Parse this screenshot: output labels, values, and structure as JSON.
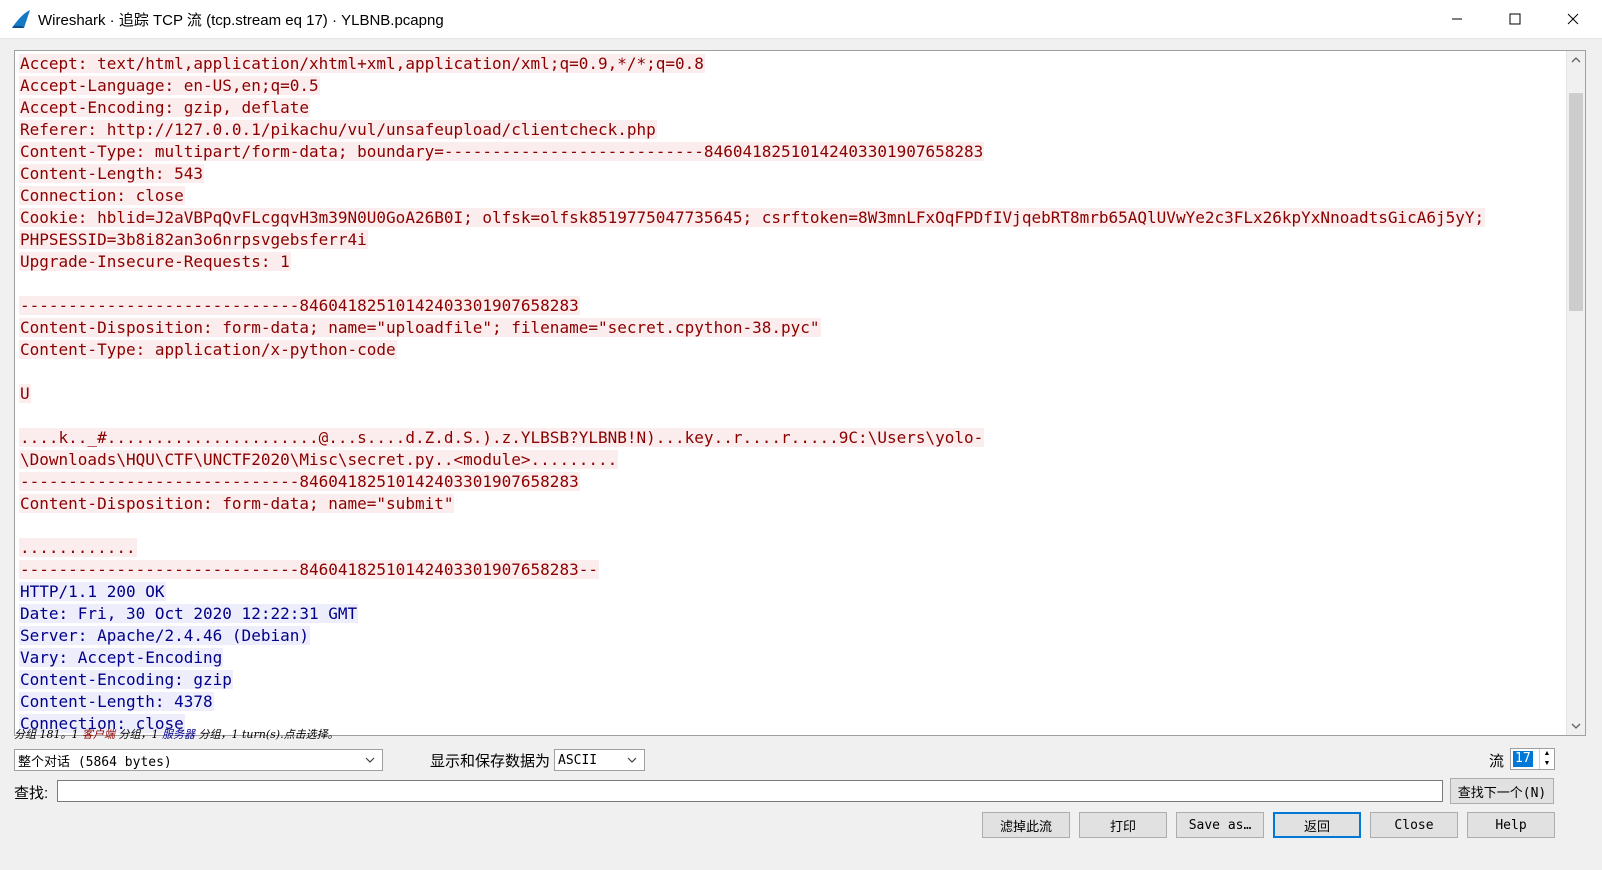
{
  "window": {
    "title": "Wireshark · 追踪 TCP 流 (tcp.stream eq 17) · YLBNB.pcapng"
  },
  "stream_lines": [
    {
      "side": "client",
      "text": "Accept: text/html,application/xhtml+xml,application/xml;q=0.9,*/*;q=0.8"
    },
    {
      "side": "client",
      "text": "Accept-Language: en-US,en;q=0.5"
    },
    {
      "side": "client",
      "text": "Accept-Encoding: gzip, deflate"
    },
    {
      "side": "client",
      "text": "Referer: http://127.0.0.1/pikachu/vul/unsafeupload/clientcheck.php"
    },
    {
      "side": "client",
      "text": "Content-Type: multipart/form-data; boundary=---------------------------84604182510142403301907658283"
    },
    {
      "side": "client",
      "text": "Content-Length: 543"
    },
    {
      "side": "client",
      "text": "Connection: close"
    },
    {
      "side": "client",
      "text": "Cookie: hblid=J2aVBPqQvFLcgqvH3m39N0U0GoA26B0I; olfsk=olfsk8519775047735645; csrftoken=8W3mnLFxOqFPDfIVjqebRT8mrb65AQlUVwYe2c3FLx26kpYxNnoadtsGicA6j5yY;"
    },
    {
      "side": "client",
      "text": "PHPSESSID=3b8i82an3o6nrpsvgebsferr4i"
    },
    {
      "side": "client",
      "text": "Upgrade-Insecure-Requests: 1"
    },
    {
      "side": "blank",
      "text": ""
    },
    {
      "side": "client",
      "text": "-----------------------------84604182510142403301907658283"
    },
    {
      "side": "client",
      "text": "Content-Disposition: form-data; name=\"uploadfile\"; filename=\"secret.cpython-38.pyc\""
    },
    {
      "side": "client",
      "text": "Content-Type: application/x-python-code"
    },
    {
      "side": "blank",
      "text": ""
    },
    {
      "side": "client",
      "text": "U"
    },
    {
      "side": "blank",
      "text": ""
    },
    {
      "side": "client",
      "text": "....k.._#......................@...s....d.Z.d.S.).z.YLBSB?YLBNB!N)...key..r....r.....9C:\\Users\\yolo-"
    },
    {
      "side": "client",
      "text": "\\Downloads\\HQU\\CTF\\UNCTF2020\\Misc\\secret.py..<module>........."
    },
    {
      "side": "client",
      "text": "-----------------------------84604182510142403301907658283"
    },
    {
      "side": "client",
      "text": "Content-Disposition: form-data; name=\"submit\""
    },
    {
      "side": "blank",
      "text": ""
    },
    {
      "side": "client",
      "text": "............"
    },
    {
      "side": "client",
      "text": "-----------------------------84604182510142403301907658283--"
    },
    {
      "side": "server",
      "text": "HTTP/1.1 200 OK"
    },
    {
      "side": "server",
      "text": "Date: Fri, 30 Oct 2020 12:22:31 GMT"
    },
    {
      "side": "server",
      "text": "Server: Apache/2.4.46 (Debian)"
    },
    {
      "side": "server",
      "text": "Vary: Accept-Encoding"
    },
    {
      "side": "server",
      "text": "Content-Encoding: gzip"
    },
    {
      "side": "server",
      "text": "Content-Length: 4378"
    },
    {
      "side": "server",
      "text": "Connection: close"
    }
  ],
  "status": {
    "part1": "分组 181。1 ",
    "client_label": "客户端",
    "part2": " 分组，1 ",
    "server_label": "服务器",
    "part3": " 分组，1 turn(s).点击选择。"
  },
  "controls": {
    "conversation_select": "整个对话 (5864 bytes)",
    "show_save_label": "显示和保存数据为",
    "format_select": "ASCII",
    "stream_label": "流",
    "stream_value": "17",
    "find_label": "查找:",
    "find_value": "",
    "find_next": "查找下一个(N)"
  },
  "buttons": {
    "filter_out": "滤掉此流",
    "print": "打印",
    "save_as": "Save as…",
    "back": "返回",
    "close": "Close",
    "help": "Help"
  },
  "colors": {
    "client_fg": "#8b0000",
    "client_bg": "#fbeded",
    "server_fg": "#00008b",
    "server_bg": "#ededfb",
    "accent": "#0078d7"
  },
  "icons": {
    "app": "wireshark-fin-icon",
    "minimize": "minimize-icon",
    "maximize": "maximize-icon",
    "close": "close-icon"
  }
}
